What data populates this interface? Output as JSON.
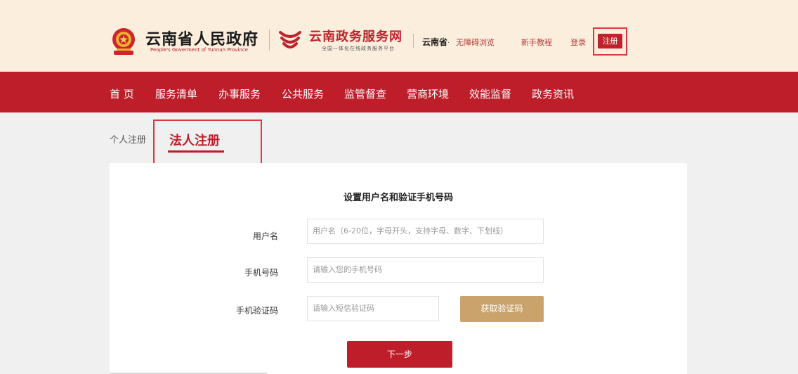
{
  "header": {
    "gov_title": "云南省人民政府",
    "gov_subtitle": "People's Goverment of Yunnan Province",
    "service_title": "云南政务服务网",
    "service_subtitle": "全国一体化在线政务服务平台",
    "region": "云南省",
    "region_caret": "·",
    "links": {
      "accessibility": "无障碍浏览",
      "guide": "新手教程",
      "login": "登录",
      "register": "注册"
    }
  },
  "nav": {
    "items": [
      "首 页",
      "服务清单",
      "办事服务",
      "公共服务",
      "监管督查",
      "营商环境",
      "效能监督",
      "政务资讯"
    ]
  },
  "tabs": {
    "personal": "个人注册",
    "legal": "法人注册"
  },
  "form": {
    "title": "设置用户名和验证手机号码",
    "username_label": "用户名",
    "username_placeholder": "用户名（6-20位，字母开头，支持字母、数字、下划线）",
    "phone_label": "手机号码",
    "phone_placeholder": "请输入您的手机号码",
    "code_label": "手机验证码",
    "code_placeholder": "请输入短信验证码",
    "get_code": "获取验证码",
    "next": "下一步"
  },
  "colors": {
    "header_bg": "#fbeedd",
    "nav_red": "#bd1e2a",
    "gold_button": "#c9a36b",
    "highlight_outline": "#e0383e"
  }
}
